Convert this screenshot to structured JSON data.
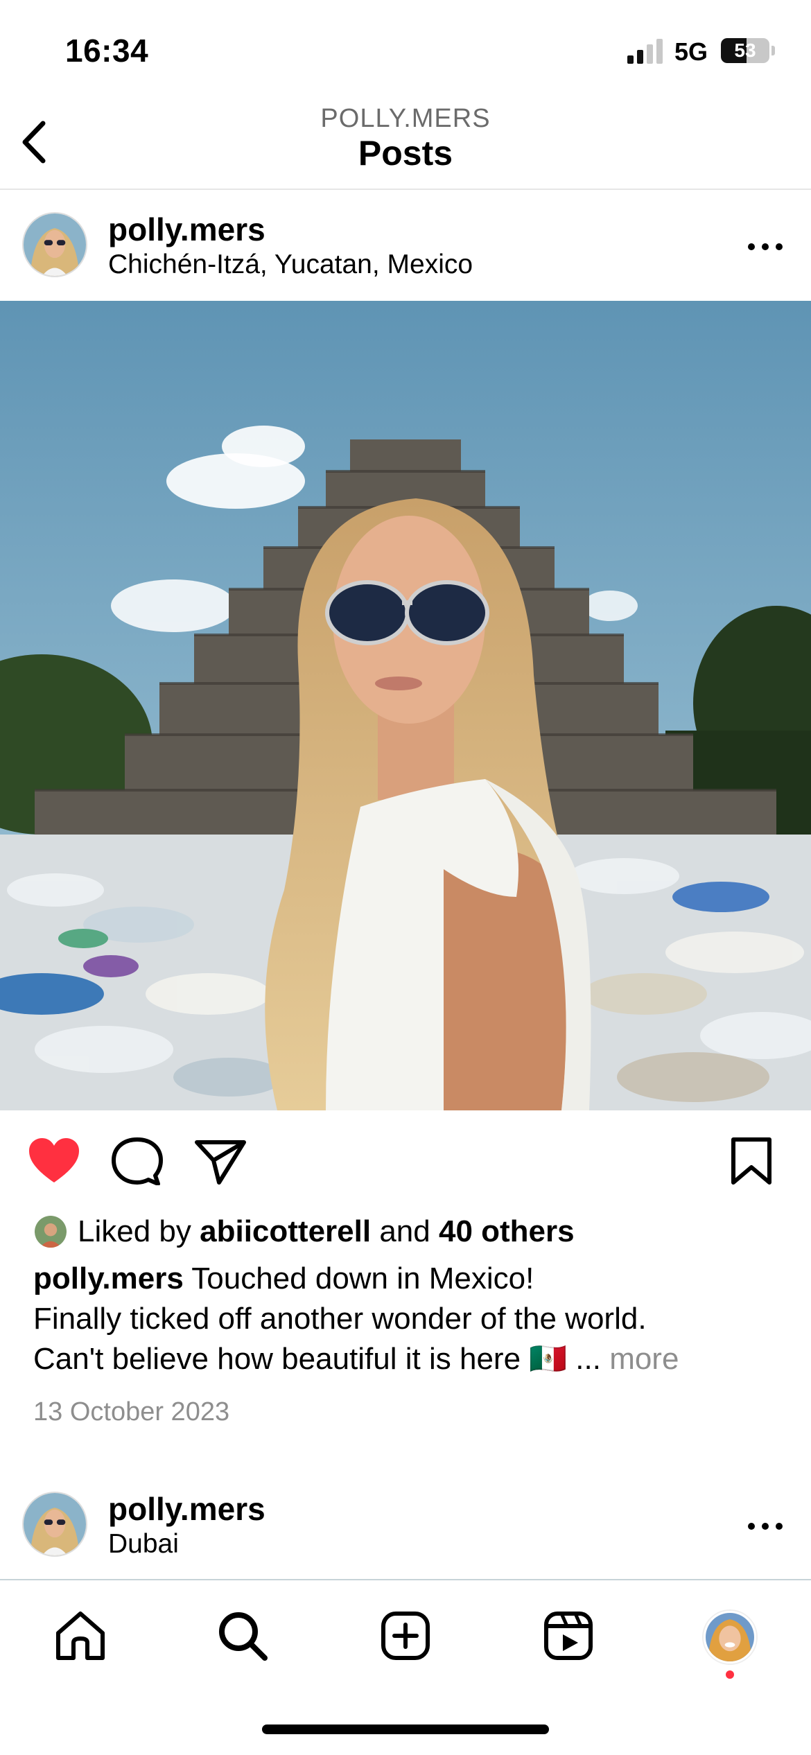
{
  "status": {
    "time": "16:34",
    "network": "5G",
    "battery": "53",
    "battery_level": 0.53
  },
  "header": {
    "subtitle": "POLLY.MERS",
    "title": "Posts",
    "back_icon": "chevron-left-icon"
  },
  "post": {
    "username": "polly.mers",
    "location": "Chichén-Itzá, Yucatan, Mexico",
    "likes_prefix": "Liked by",
    "liked_by": "abiicotterell",
    "likes_and": "and",
    "likes_others": "40 others",
    "caption_user": "polly.mers",
    "caption_line1": "Touched down in Mexico!",
    "caption_line2": "Finally ticked off another wonder of the world.",
    "caption_line3": "Can't believe how beautiful it is here 🇲🇽 ...",
    "more_label": "more",
    "date": "13 October 2023",
    "liked": true
  },
  "next_post": {
    "username": "polly.mers",
    "location": "Dubai"
  },
  "nav": {
    "items": [
      "home-icon",
      "search-icon",
      "create-icon",
      "reels-icon",
      "profile-avatar"
    ]
  },
  "colors": {
    "like": "#ff3040",
    "muted": "#8e8e8e"
  }
}
